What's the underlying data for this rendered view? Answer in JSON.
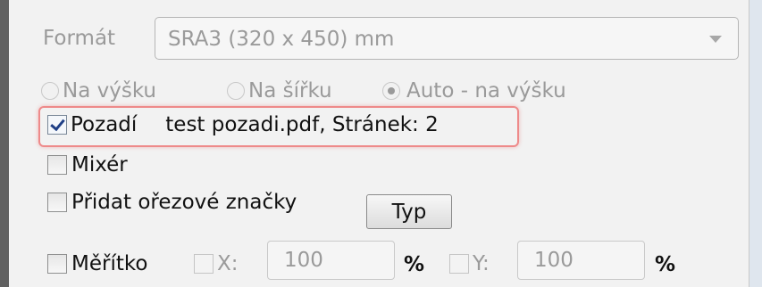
{
  "format": {
    "label": "Formát",
    "value": "SRA3 (320 x 450) mm"
  },
  "orientation": {
    "options": [
      {
        "label": "Na výšku",
        "selected": false
      },
      {
        "label": "Na šířku",
        "selected": false
      },
      {
        "label": "Auto - na výšku",
        "selected": true
      }
    ]
  },
  "background": {
    "label": "Pozadí",
    "checked": true,
    "info": "test pozadi.pdf, Stránek: 2"
  },
  "mixer": {
    "label": "Mixér",
    "checked": false
  },
  "crop_marks": {
    "label": "Přidat ořezové značky",
    "checked": false,
    "type_button": "Typ"
  },
  "scale": {
    "label": "Měřítko",
    "checked": false,
    "x_label": "X:",
    "x_value": "100",
    "x_unit": "%",
    "y_label": "Y:",
    "y_value": "100",
    "y_unit": "%"
  },
  "colors": {
    "highlight": "#ee8a8a",
    "check": "#1f3f86",
    "disabled_text": "#9a9a9a"
  }
}
